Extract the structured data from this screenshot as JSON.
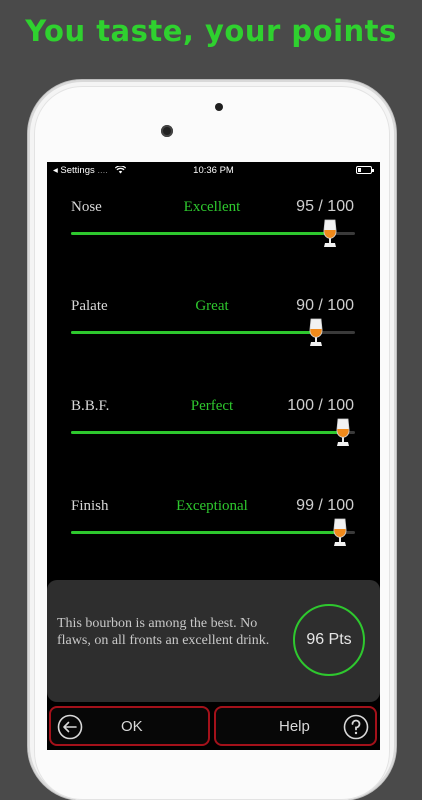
{
  "headline": "You taste, your points",
  "status_bar": {
    "carrier": "◂ Settings",
    "time": "10:36 PM"
  },
  "ratings": [
    {
      "label": "Nose",
      "word": "Excellent",
      "score": "95 / 100",
      "value": 95
    },
    {
      "label": "Palate",
      "word": "Great",
      "score": "90 / 100",
      "value": 90
    },
    {
      "label": "B.B.F.",
      "word": "Perfect",
      "score": "100 / 100",
      "value": 100
    },
    {
      "label": "Finish",
      "word": "Exceptional",
      "score": "99 / 100",
      "value": 99
    }
  ],
  "summary": {
    "text": "This bourbon is among the best. No flaws, on all fronts an excellent drink.",
    "points": "96 Pts"
  },
  "buttons": {
    "ok": "OK",
    "help": "Help"
  },
  "colors": {
    "accent": "#2ec82e",
    "button_border": "#a3111a",
    "glass_fill": "#f08a1c"
  },
  "icons": {
    "back": "arrow-left-circle-icon",
    "help": "question-circle-icon",
    "thumb": "tasting-glass-icon"
  }
}
